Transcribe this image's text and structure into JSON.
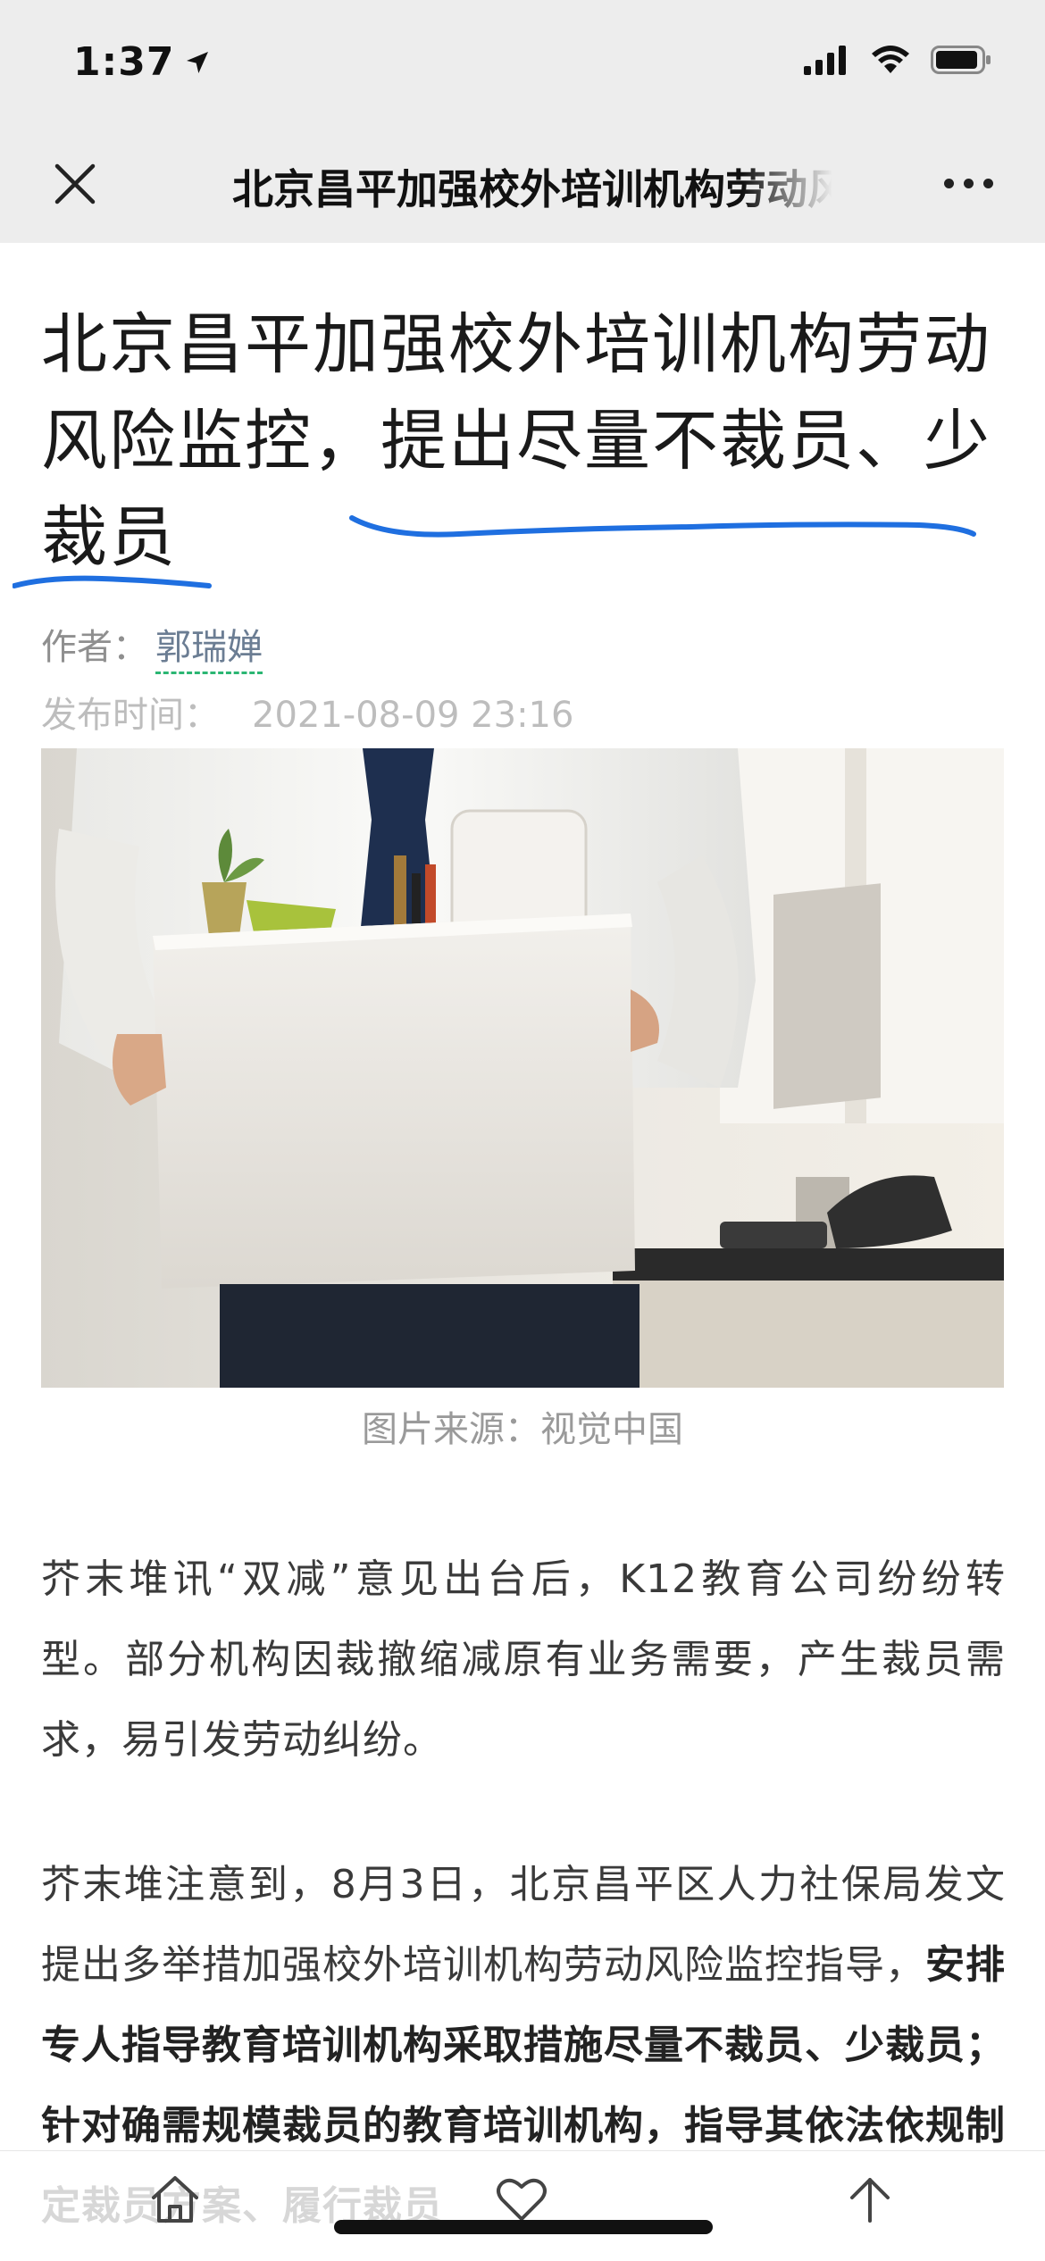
{
  "status_bar": {
    "time": "1:37"
  },
  "nav": {
    "title": "北京昌平加强校外培训机构劳动风险监控，提出尽量不裁员、少裁员"
  },
  "article": {
    "headline_part1": "北京昌平加强校外培训机构劳动风险监控，",
    "headline_part2": "提出尽量不裁员、少裁员",
    "author_label": "作者：",
    "author_name": "郭瑞婵",
    "publish_label": "发布时间：",
    "publish_time": "2021-08-09 23:16",
    "image_caption": "图片来源：视觉中国",
    "paragraph1": "芥末堆讯“双减”意见出台后，K12教育公司纷纷转型。部分机构因裁撤缩减原有业务需要，产生裁员需求，易引发劳动纠纷。",
    "paragraph2_lead": "芥末堆注意到，8月3日，北京昌平区人力社保局发文提出多举措加强校外培训机构劳动风险监控指导，",
    "paragraph2_bold": "安排专人指导教育培训机构采取措施尽量不裁员、少裁员；针对确需规模裁员的教育培训",
    "paragraph2_tail": "机构，指导其依法依规制定裁员方案、履行裁员"
  },
  "icons": {
    "close": "close-icon",
    "more": "more-icon",
    "home": "home-icon",
    "like": "heart-icon",
    "top": "arrow-up-icon"
  },
  "colors": {
    "underline": "#1f6fe0",
    "author_dashed": "#2bb673"
  }
}
